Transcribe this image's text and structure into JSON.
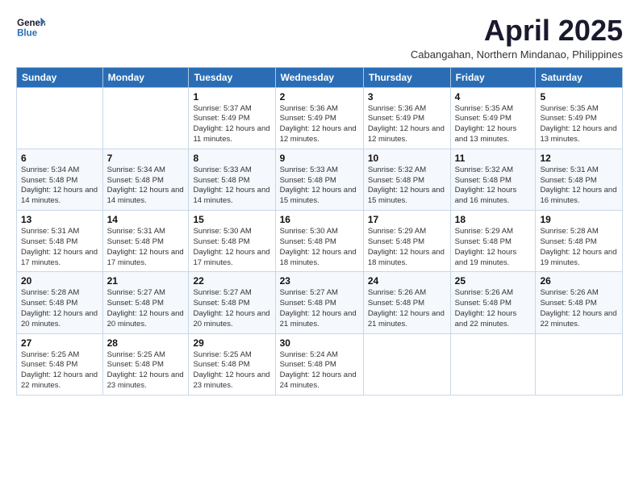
{
  "logo": {
    "line1": "General",
    "line2": "Blue"
  },
  "header": {
    "month": "April 2025",
    "location": "Cabangahan, Northern Mindanao, Philippines"
  },
  "weekdays": [
    "Sunday",
    "Monday",
    "Tuesday",
    "Wednesday",
    "Thursday",
    "Friday",
    "Saturday"
  ],
  "weeks": [
    [
      {
        "day": "",
        "info": ""
      },
      {
        "day": "",
        "info": ""
      },
      {
        "day": "1",
        "info": "Sunrise: 5:37 AM\nSunset: 5:49 PM\nDaylight: 12 hours and 11 minutes."
      },
      {
        "day": "2",
        "info": "Sunrise: 5:36 AM\nSunset: 5:49 PM\nDaylight: 12 hours and 12 minutes."
      },
      {
        "day": "3",
        "info": "Sunrise: 5:36 AM\nSunset: 5:49 PM\nDaylight: 12 hours and 12 minutes."
      },
      {
        "day": "4",
        "info": "Sunrise: 5:35 AM\nSunset: 5:49 PM\nDaylight: 12 hours and 13 minutes."
      },
      {
        "day": "5",
        "info": "Sunrise: 5:35 AM\nSunset: 5:49 PM\nDaylight: 12 hours and 13 minutes."
      }
    ],
    [
      {
        "day": "6",
        "info": "Sunrise: 5:34 AM\nSunset: 5:48 PM\nDaylight: 12 hours and 14 minutes."
      },
      {
        "day": "7",
        "info": "Sunrise: 5:34 AM\nSunset: 5:48 PM\nDaylight: 12 hours and 14 minutes."
      },
      {
        "day": "8",
        "info": "Sunrise: 5:33 AM\nSunset: 5:48 PM\nDaylight: 12 hours and 14 minutes."
      },
      {
        "day": "9",
        "info": "Sunrise: 5:33 AM\nSunset: 5:48 PM\nDaylight: 12 hours and 15 minutes."
      },
      {
        "day": "10",
        "info": "Sunrise: 5:32 AM\nSunset: 5:48 PM\nDaylight: 12 hours and 15 minutes."
      },
      {
        "day": "11",
        "info": "Sunrise: 5:32 AM\nSunset: 5:48 PM\nDaylight: 12 hours and 16 minutes."
      },
      {
        "day": "12",
        "info": "Sunrise: 5:31 AM\nSunset: 5:48 PM\nDaylight: 12 hours and 16 minutes."
      }
    ],
    [
      {
        "day": "13",
        "info": "Sunrise: 5:31 AM\nSunset: 5:48 PM\nDaylight: 12 hours and 17 minutes."
      },
      {
        "day": "14",
        "info": "Sunrise: 5:31 AM\nSunset: 5:48 PM\nDaylight: 12 hours and 17 minutes."
      },
      {
        "day": "15",
        "info": "Sunrise: 5:30 AM\nSunset: 5:48 PM\nDaylight: 12 hours and 17 minutes."
      },
      {
        "day": "16",
        "info": "Sunrise: 5:30 AM\nSunset: 5:48 PM\nDaylight: 12 hours and 18 minutes."
      },
      {
        "day": "17",
        "info": "Sunrise: 5:29 AM\nSunset: 5:48 PM\nDaylight: 12 hours and 18 minutes."
      },
      {
        "day": "18",
        "info": "Sunrise: 5:29 AM\nSunset: 5:48 PM\nDaylight: 12 hours and 19 minutes."
      },
      {
        "day": "19",
        "info": "Sunrise: 5:28 AM\nSunset: 5:48 PM\nDaylight: 12 hours and 19 minutes."
      }
    ],
    [
      {
        "day": "20",
        "info": "Sunrise: 5:28 AM\nSunset: 5:48 PM\nDaylight: 12 hours and 20 minutes."
      },
      {
        "day": "21",
        "info": "Sunrise: 5:27 AM\nSunset: 5:48 PM\nDaylight: 12 hours and 20 minutes."
      },
      {
        "day": "22",
        "info": "Sunrise: 5:27 AM\nSunset: 5:48 PM\nDaylight: 12 hours and 20 minutes."
      },
      {
        "day": "23",
        "info": "Sunrise: 5:27 AM\nSunset: 5:48 PM\nDaylight: 12 hours and 21 minutes."
      },
      {
        "day": "24",
        "info": "Sunrise: 5:26 AM\nSunset: 5:48 PM\nDaylight: 12 hours and 21 minutes."
      },
      {
        "day": "25",
        "info": "Sunrise: 5:26 AM\nSunset: 5:48 PM\nDaylight: 12 hours and 22 minutes."
      },
      {
        "day": "26",
        "info": "Sunrise: 5:26 AM\nSunset: 5:48 PM\nDaylight: 12 hours and 22 minutes."
      }
    ],
    [
      {
        "day": "27",
        "info": "Sunrise: 5:25 AM\nSunset: 5:48 PM\nDaylight: 12 hours and 22 minutes."
      },
      {
        "day": "28",
        "info": "Sunrise: 5:25 AM\nSunset: 5:48 PM\nDaylight: 12 hours and 23 minutes."
      },
      {
        "day": "29",
        "info": "Sunrise: 5:25 AM\nSunset: 5:48 PM\nDaylight: 12 hours and 23 minutes."
      },
      {
        "day": "30",
        "info": "Sunrise: 5:24 AM\nSunset: 5:48 PM\nDaylight: 12 hours and 24 minutes."
      },
      {
        "day": "",
        "info": ""
      },
      {
        "day": "",
        "info": ""
      },
      {
        "day": "",
        "info": ""
      }
    ]
  ]
}
